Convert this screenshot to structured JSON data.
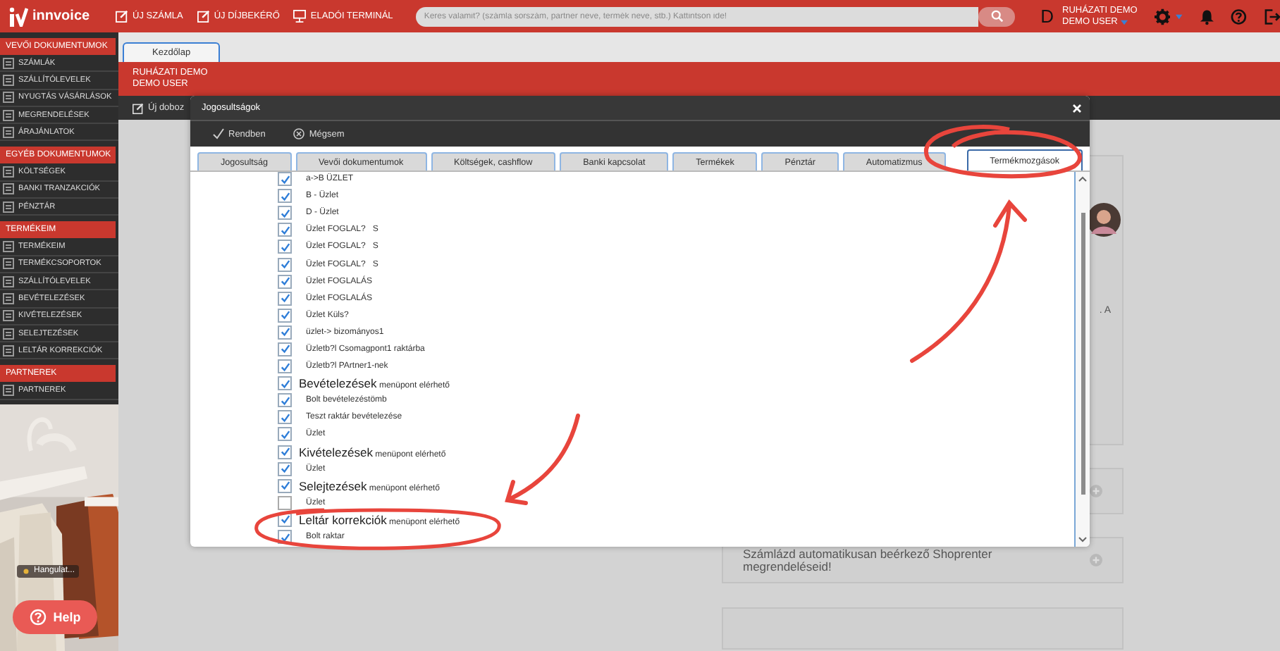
{
  "topbar": {
    "logo": "innvoice",
    "actions": [
      "ÚJ SZÁMLA",
      "ÚJ DÍJBEKÉRŐ",
      "ELADÓI TERMINÁL"
    ],
    "search": {
      "placeholder": "Keres valamit? (számla sorszám, partner neve, termék neve, stb.) Kattintson ide!"
    },
    "avatar_letter": "D",
    "user": {
      "company": "RUHÁZATI DEMO",
      "name": "DEMO USER"
    }
  },
  "sidebar": {
    "sections": [
      {
        "title": "VEVŐI DOKUMENTUMOK",
        "items": [
          "SZÁMLÁK",
          "SZÁLLÍTÓLEVELEK",
          "NYUGTÁS VÁSÁRLÁSOK",
          "MEGRENDELÉSEK",
          "ÁRAJÁNLATOK"
        ]
      },
      {
        "title": "EGYÉB DOKUMENTUMOK",
        "items": [
          "KÖLTSÉGEK",
          "BANKI TRANZAKCIÓK",
          "PÉNZTÁR"
        ]
      },
      {
        "title": "TERMÉKEIM",
        "items": [
          "TERMÉKEIM",
          "TERMÉKCSOPORTOK",
          "SZÁLLÍTÓLEVELEK",
          "BEVÉTELEZÉSEK",
          "KIVÉTELEZÉSEK",
          "SELEJTEZÉSEK",
          "LELTÁR KORREKCIÓK"
        ]
      },
      {
        "title": "PARTNEREK",
        "items": [
          "PARTNEREK"
        ]
      }
    ],
    "promo": {
      "kind": "picture",
      "caption": "Hangulat..."
    }
  },
  "help_button": "Help",
  "tabs": [
    {
      "label": "Kezdőlap",
      "selected": true
    }
  ],
  "banner": {
    "company": "RUHÁZATI DEMO",
    "user": "DEMO USER"
  },
  "toolbar": {
    "button": "Új doboz"
  },
  "cards": [
    {
      "kind": "profile",
      "text": ". A"
    },
    {
      "kind": "collapsed"
    },
    {
      "kind": "collapsed",
      "text": "Számlázd automatikusan beérkező Shoprenter megrendeléseid!"
    },
    {
      "kind": "blank"
    }
  ],
  "dialog": {
    "title": "Jogosultságok",
    "buttons": [
      "Rendben",
      "Mégsem"
    ],
    "tabs": [
      {
        "label": "Jogosultság",
        "selected": false
      },
      {
        "label": "Vevői dokumentumok",
        "selected": false
      },
      {
        "label": "Költségek, cashflow",
        "selected": false
      },
      {
        "label": "Banki kapcsolat",
        "selected": false
      },
      {
        "label": "Termékek",
        "selected": false
      },
      {
        "label": "Pénztár",
        "selected": false
      },
      {
        "label": "Automatizmus",
        "selected": false
      },
      {
        "label": "Termékmozgások",
        "selected": true
      }
    ],
    "rows": [
      {
        "kind": "item",
        "label": "a->B ÜZLET",
        "checked": true
      },
      {
        "kind": "item",
        "label": "B - Üzlet",
        "checked": true
      },
      {
        "kind": "item",
        "label": "D - Üzlet",
        "checked": true
      },
      {
        "kind": "item",
        "label": "Üzlet FOGLAL?   S",
        "checked": true
      },
      {
        "kind": "item",
        "label": "Üzlet FOGLAL?   S",
        "checked": true
      },
      {
        "kind": "item",
        "label": "Üzlet FOGLAL?   S",
        "checked": true
      },
      {
        "kind": "item",
        "label": "Üzlet FOGLALÁS",
        "checked": true
      },
      {
        "kind": "item",
        "label": "Üzlet FOGLALÁS",
        "checked": true
      },
      {
        "kind": "item",
        "label": "Üzlet Küls?",
        "checked": true
      },
      {
        "kind": "item",
        "label": "üzlet-> bizományos1",
        "checked": true
      },
      {
        "kind": "item",
        "label": "Üzletb?l Csomagpont1 raktárba",
        "checked": true
      },
      {
        "kind": "item",
        "label": "Üzletb?l PArtner1-nek",
        "checked": true
      },
      {
        "kind": "header",
        "title": "Bevételezések",
        "suffix": "menüpont elérhető",
        "checked": true
      },
      {
        "kind": "item",
        "label": "Bolt bevételezéstömb",
        "checked": true
      },
      {
        "kind": "item",
        "label": "Teszt raktár bevételezése",
        "checked": true
      },
      {
        "kind": "item",
        "label": "Üzlet",
        "checked": true
      },
      {
        "kind": "header",
        "title": "Kivételezések",
        "suffix": "menüpont elérhető",
        "checked": true
      },
      {
        "kind": "item",
        "label": "Üzlet",
        "checked": true
      },
      {
        "kind": "header",
        "title": "Selejtezések",
        "suffix": "menüpont elérhető",
        "checked": true
      },
      {
        "kind": "item",
        "label": "Üzlet",
        "checked": false
      },
      {
        "kind": "header",
        "title": "Leltár korrekciók",
        "suffix": "menüpont elérhető",
        "checked": true
      },
      {
        "kind": "item",
        "label": "Bolt raktar",
        "checked": true
      }
    ]
  }
}
